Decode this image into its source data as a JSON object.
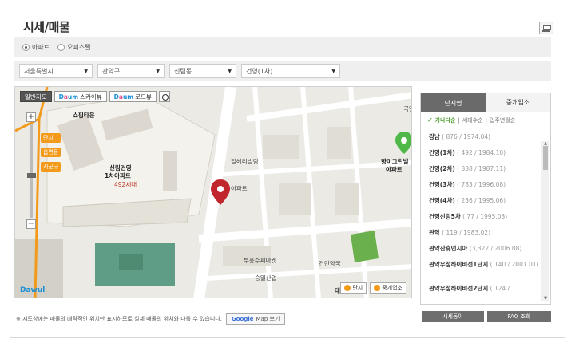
{
  "title": "시세/매물",
  "property_types": [
    {
      "label": "아파트",
      "selected": true
    },
    {
      "label": "오피스텔",
      "selected": false
    }
  ],
  "filters": [
    {
      "value": "서울특별시"
    },
    {
      "value": "관악구"
    },
    {
      "value": "신림동"
    },
    {
      "value": "건영(1차)"
    }
  ],
  "map": {
    "tools": {
      "basic": "일반지도",
      "skyview": "스카이뷰",
      "roadview": "로드뷰",
      "brand_d": "D",
      "brand_a": "a",
      "brand_um": "um"
    },
    "zoom_labels": [
      "단지",
      "읍면동",
      "시군구"
    ],
    "labels": {
      "shopping": "쇼핑타운",
      "sillim": "신림건영",
      "sillim2": "1차아파트",
      "units": "492세대",
      "ilheri": "일헤리빌딩",
      "apt": "아파트",
      "hyangmi": "향미그린빌",
      "hyangmi2": "아파트",
      "gukmin": "국민",
      "buheung": "부흥수퍼마켓",
      "geonmin": "건민약국",
      "seungil": "승일산업",
      "dae": "대"
    },
    "logo": "Dawul",
    "legend": {
      "complex": "단지",
      "agent": "중개업소"
    }
  },
  "side_panel": {
    "tabs": [
      "단지명",
      "중개업소"
    ],
    "sort": {
      "active": "가나다순",
      "others": [
        "세대수순",
        "입주년월순"
      ]
    },
    "complexes": [
      {
        "name": "강남",
        "meta": "( 876 / 1974.04)"
      },
      {
        "name": "건영(1차)",
        "meta": "( 492 / 1984.10)"
      },
      {
        "name": "건영(2차)",
        "meta": "( 338 / 1987.11)"
      },
      {
        "name": "건영(3차)",
        "meta": "( 783 / 1996.08)"
      },
      {
        "name": "건영(4차)",
        "meta": "( 236 / 1995.06)"
      },
      {
        "name": "건영신림5차",
        "meta": "( 77 / 1995.03)"
      },
      {
        "name": "관악",
        "meta": "( 119 / 1983.02)"
      },
      {
        "name": "관악산휴먼시아",
        "meta": "(3,322 / 2006.08)"
      },
      {
        "name": "관악우정하이비전1단지",
        "meta": "( 140 / 2003.01)"
      },
      {
        "name": "관악우정하이비전2단지",
        "meta": "( 124 /"
      }
    ]
  },
  "footnote": "※ 지도상에는 매물의 대략적인 위치만 표시하므로 실제 매물의 위치와 다를 수 있습니다.",
  "google_button": {
    "brand": "Google",
    "label": "Map 보기"
  },
  "bottom_buttons": [
    "시세동이",
    "FAQ 조회"
  ]
}
